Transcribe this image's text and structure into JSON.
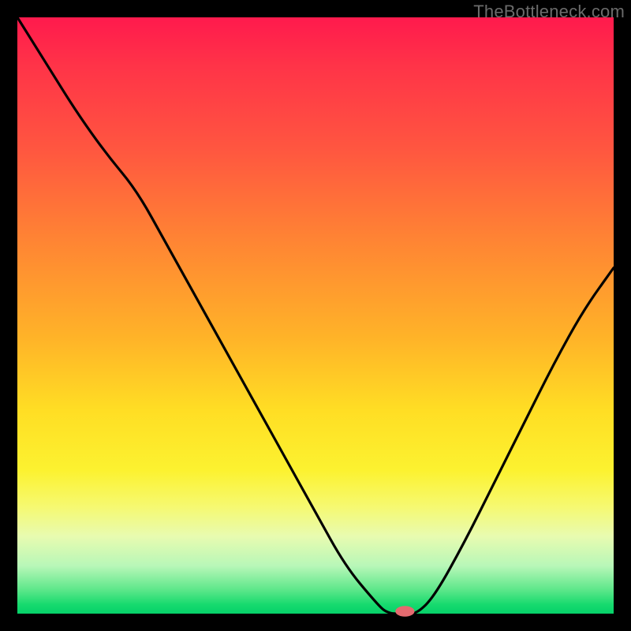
{
  "watermark": "TheBottleneck.com",
  "colors": {
    "frame": "#000000",
    "curve": "#000000",
    "marker": "#e46a6f",
    "gradient_top": "#ff1a4d",
    "gradient_bottom": "#06d169"
  },
  "chart_data": {
    "type": "line",
    "title": "",
    "xlabel": "",
    "ylabel": "",
    "xlim": [
      0,
      100
    ],
    "ylim": [
      0,
      100
    ],
    "x": [
      0,
      5,
      10,
      15,
      20,
      25,
      30,
      35,
      40,
      45,
      50,
      55,
      60,
      62,
      65,
      67,
      70,
      75,
      80,
      85,
      90,
      95,
      100
    ],
    "values": [
      100,
      92,
      84,
      77,
      71,
      62,
      53,
      44,
      35,
      26,
      17,
      8,
      2,
      0,
      0,
      0,
      3,
      12,
      22,
      32,
      42,
      51,
      58
    ],
    "marker": {
      "x": 65,
      "y": 0,
      "rx": 1.6,
      "ry": 0.9
    },
    "note": "y=0 is bottom (green); y=100 is top (red). Curve dips to baseline near x≈62–67."
  }
}
